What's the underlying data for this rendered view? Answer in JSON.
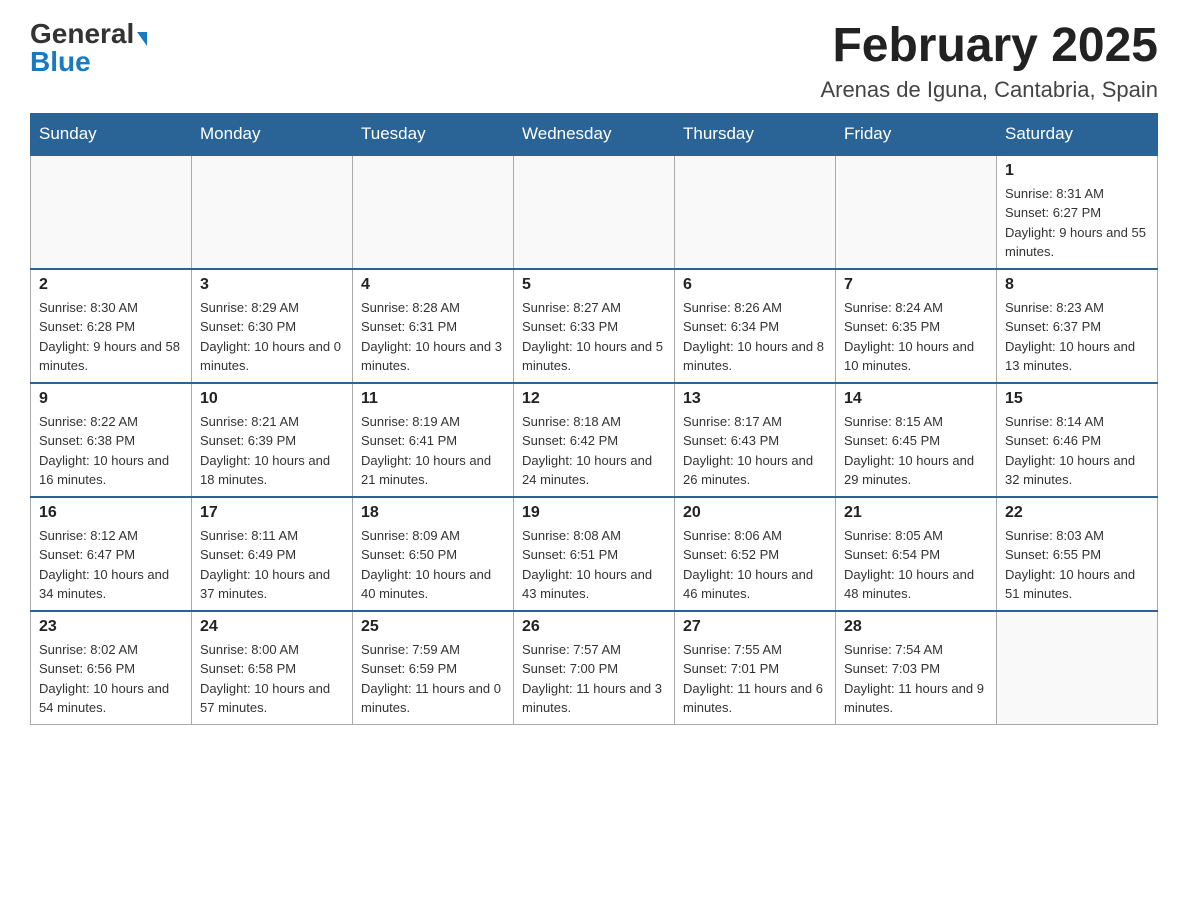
{
  "logo": {
    "general": "General",
    "blue": "Blue"
  },
  "title": {
    "month_year": "February 2025",
    "location": "Arenas de Iguna, Cantabria, Spain"
  },
  "weekdays": [
    "Sunday",
    "Monday",
    "Tuesday",
    "Wednesday",
    "Thursday",
    "Friday",
    "Saturday"
  ],
  "weeks": [
    [
      {
        "day": "",
        "info": ""
      },
      {
        "day": "",
        "info": ""
      },
      {
        "day": "",
        "info": ""
      },
      {
        "day": "",
        "info": ""
      },
      {
        "day": "",
        "info": ""
      },
      {
        "day": "",
        "info": ""
      },
      {
        "day": "1",
        "info": "Sunrise: 8:31 AM\nSunset: 6:27 PM\nDaylight: 9 hours and 55 minutes."
      }
    ],
    [
      {
        "day": "2",
        "info": "Sunrise: 8:30 AM\nSunset: 6:28 PM\nDaylight: 9 hours and 58 minutes."
      },
      {
        "day": "3",
        "info": "Sunrise: 8:29 AM\nSunset: 6:30 PM\nDaylight: 10 hours and 0 minutes."
      },
      {
        "day": "4",
        "info": "Sunrise: 8:28 AM\nSunset: 6:31 PM\nDaylight: 10 hours and 3 minutes."
      },
      {
        "day": "5",
        "info": "Sunrise: 8:27 AM\nSunset: 6:33 PM\nDaylight: 10 hours and 5 minutes."
      },
      {
        "day": "6",
        "info": "Sunrise: 8:26 AM\nSunset: 6:34 PM\nDaylight: 10 hours and 8 minutes."
      },
      {
        "day": "7",
        "info": "Sunrise: 8:24 AM\nSunset: 6:35 PM\nDaylight: 10 hours and 10 minutes."
      },
      {
        "day": "8",
        "info": "Sunrise: 8:23 AM\nSunset: 6:37 PM\nDaylight: 10 hours and 13 minutes."
      }
    ],
    [
      {
        "day": "9",
        "info": "Sunrise: 8:22 AM\nSunset: 6:38 PM\nDaylight: 10 hours and 16 minutes."
      },
      {
        "day": "10",
        "info": "Sunrise: 8:21 AM\nSunset: 6:39 PM\nDaylight: 10 hours and 18 minutes."
      },
      {
        "day": "11",
        "info": "Sunrise: 8:19 AM\nSunset: 6:41 PM\nDaylight: 10 hours and 21 minutes."
      },
      {
        "day": "12",
        "info": "Sunrise: 8:18 AM\nSunset: 6:42 PM\nDaylight: 10 hours and 24 minutes."
      },
      {
        "day": "13",
        "info": "Sunrise: 8:17 AM\nSunset: 6:43 PM\nDaylight: 10 hours and 26 minutes."
      },
      {
        "day": "14",
        "info": "Sunrise: 8:15 AM\nSunset: 6:45 PM\nDaylight: 10 hours and 29 minutes."
      },
      {
        "day": "15",
        "info": "Sunrise: 8:14 AM\nSunset: 6:46 PM\nDaylight: 10 hours and 32 minutes."
      }
    ],
    [
      {
        "day": "16",
        "info": "Sunrise: 8:12 AM\nSunset: 6:47 PM\nDaylight: 10 hours and 34 minutes."
      },
      {
        "day": "17",
        "info": "Sunrise: 8:11 AM\nSunset: 6:49 PM\nDaylight: 10 hours and 37 minutes."
      },
      {
        "day": "18",
        "info": "Sunrise: 8:09 AM\nSunset: 6:50 PM\nDaylight: 10 hours and 40 minutes."
      },
      {
        "day": "19",
        "info": "Sunrise: 8:08 AM\nSunset: 6:51 PM\nDaylight: 10 hours and 43 minutes."
      },
      {
        "day": "20",
        "info": "Sunrise: 8:06 AM\nSunset: 6:52 PM\nDaylight: 10 hours and 46 minutes."
      },
      {
        "day": "21",
        "info": "Sunrise: 8:05 AM\nSunset: 6:54 PM\nDaylight: 10 hours and 48 minutes."
      },
      {
        "day": "22",
        "info": "Sunrise: 8:03 AM\nSunset: 6:55 PM\nDaylight: 10 hours and 51 minutes."
      }
    ],
    [
      {
        "day": "23",
        "info": "Sunrise: 8:02 AM\nSunset: 6:56 PM\nDaylight: 10 hours and 54 minutes."
      },
      {
        "day": "24",
        "info": "Sunrise: 8:00 AM\nSunset: 6:58 PM\nDaylight: 10 hours and 57 minutes."
      },
      {
        "day": "25",
        "info": "Sunrise: 7:59 AM\nSunset: 6:59 PM\nDaylight: 11 hours and 0 minutes."
      },
      {
        "day": "26",
        "info": "Sunrise: 7:57 AM\nSunset: 7:00 PM\nDaylight: 11 hours and 3 minutes."
      },
      {
        "day": "27",
        "info": "Sunrise: 7:55 AM\nSunset: 7:01 PM\nDaylight: 11 hours and 6 minutes."
      },
      {
        "day": "28",
        "info": "Sunrise: 7:54 AM\nSunset: 7:03 PM\nDaylight: 11 hours and 9 minutes."
      },
      {
        "day": "",
        "info": ""
      }
    ]
  ]
}
